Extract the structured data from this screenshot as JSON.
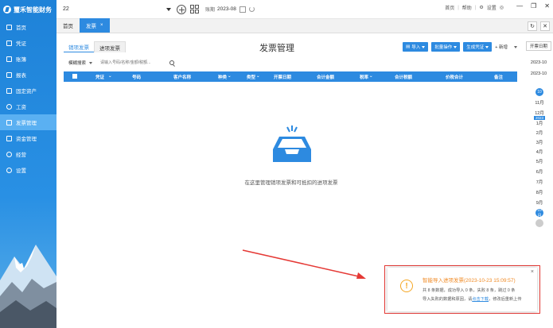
{
  "brand": {
    "name": "璽禾智能财务"
  },
  "sidebar": {
    "items": [
      {
        "label": "首页",
        "active": false
      },
      {
        "label": "凭证",
        "active": false
      },
      {
        "label": "账簿",
        "active": false
      },
      {
        "label": "报表",
        "active": false
      },
      {
        "label": "固定资产",
        "active": false
      },
      {
        "label": "工资",
        "active": false
      },
      {
        "label": "发票管理",
        "active": true
      },
      {
        "label": "资金管理",
        "active": false
      },
      {
        "label": "经营",
        "active": false
      },
      {
        "label": "设置",
        "active": false
      }
    ]
  },
  "topbar": {
    "account_value": "22",
    "period_label": "账期",
    "period_value": "2023-08",
    "links": [
      "首页",
      "帮助",
      "设置"
    ]
  },
  "tabs": {
    "home_label": "首页",
    "active_label": "发票",
    "close_glyph": "×"
  },
  "main": {
    "subtabs": [
      "销项发票",
      "进项发票"
    ],
    "title": "发票管理",
    "actions": {
      "import_label": "导入",
      "batch_label": "批量操作",
      "voucher_label": "生成凭证",
      "add_label": "+ 新增"
    },
    "filter": {
      "mode_label": "模糊搜索",
      "search_placeholder": "请输入号码/名称/金额/税额..."
    },
    "table": {
      "headers": [
        "凭证",
        "号码",
        "客户名称",
        "种类",
        "类型",
        "开票日期",
        "合计金额",
        "税率",
        "合计税额",
        "价税合计",
        "备注"
      ]
    },
    "empty_text": "在这里管理销项发票和可抵扣的进项发票"
  },
  "year_panel": {
    "link_label": "开票日期",
    "period_a": "2023-10",
    "period_b": "2023-10",
    "months": [
      {
        "label": "10",
        "kind": "dot"
      },
      {
        "label": "11月",
        "kind": "text"
      },
      {
        "label": "12月",
        "kind": "text"
      },
      {
        "label": "2023",
        "kind": "tag"
      },
      {
        "label": "1月",
        "kind": "text"
      },
      {
        "label": "2月",
        "kind": "text"
      },
      {
        "label": "3月",
        "kind": "text"
      },
      {
        "label": "4月",
        "kind": "text"
      },
      {
        "label": "5月",
        "kind": "text"
      },
      {
        "label": "6月",
        "kind": "text"
      },
      {
        "label": "7月",
        "kind": "text"
      },
      {
        "label": "8月",
        "kind": "text"
      },
      {
        "label": "9月",
        "kind": "text"
      },
      {
        "label": "10月",
        "kind": "dot"
      },
      {
        "label": "",
        "kind": "grey"
      }
    ]
  },
  "notification": {
    "title": "智能导入进项发票(2023-10-23 15:09:57)",
    "line1": "共 8 条数据，成功导入 0 条，失败 8 条，跳过 0 条",
    "line2_prefix": "导入失败的数据和原因，请",
    "line2_link": "点击下载",
    "line2_suffix": "，修改后重新上传",
    "close_glyph": "×"
  },
  "colors": {
    "primary": "#2d8ae0",
    "warning": "#f5a623",
    "annotation": "#e53935"
  }
}
